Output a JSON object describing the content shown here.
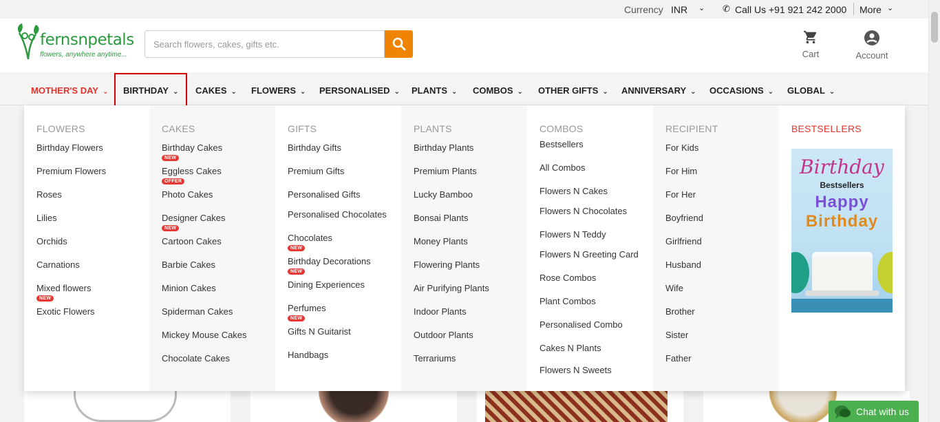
{
  "topbar": {
    "currency_label": "Currency",
    "currency_value": "INR",
    "call": "Call Us +91 921 242 2000",
    "more": "More"
  },
  "header": {
    "logo_brand": "fernsnpetals",
    "logo_tagline": "flowers, anywhere anytime...",
    "search_placeholder": "Search flowers, cakes, gifts etc.",
    "cart_label": "Cart",
    "account_label": "Account"
  },
  "nav": {
    "items": [
      "MOTHER'S DAY",
      "BIRTHDAY",
      "CAKES",
      "FLOWERS",
      "PERSONALISED",
      "PLANTS",
      "COMBOS",
      "OTHER GIFTS",
      "ANNIVERSARY",
      "OCCASIONS",
      "GLOBAL"
    ],
    "accent_color": "#e2342c"
  },
  "mega_menu": {
    "flowers": {
      "title": "FLOWERS",
      "items": [
        "Birthday Flowers",
        "Premium Flowers",
        "Roses",
        "Lilies",
        "Orchids",
        "Carnations",
        "Mixed flowers",
        "Exotic Flowers"
      ],
      "badges": {
        "7": "NEW"
      }
    },
    "cakes": {
      "title": "CAKES",
      "items": [
        "Birthday Cakes",
        "Eggless Cakes",
        "Photo Cakes",
        "Designer Cakes",
        "Cartoon Cakes",
        "Barbie Cakes",
        "Minion Cakes",
        "Spiderman Cakes",
        "Mickey Mouse Cakes",
        "Chocolate Cakes"
      ],
      "badges": {
        "1": "NEW",
        "2": "OFFER",
        "4": "NEW"
      }
    },
    "gifts": {
      "title": "GIFTS",
      "items": [
        "Birthday Gifts",
        "Premium Gifts",
        "Personalised Gifts",
        "Personalised Chocolates",
        "Chocolates",
        "Birthday Decorations",
        "Dining Experiences",
        "Perfumes",
        "Gifts N Guitarist",
        "Handbags"
      ],
      "badges": {
        "5": "NEW",
        "6": "NEW",
        "8": "NEW"
      }
    },
    "plants": {
      "title": "PLANTS",
      "items": [
        "Birthday Plants",
        "Premium Plants",
        "Lucky Bamboo",
        "Bonsai Plants",
        "Money Plants",
        "Flowering Plants",
        "Air Purifying Plants",
        "Indoor Plants",
        "Outdoor Plants",
        "Terrariums"
      ]
    },
    "combos": {
      "title": "COMBOS",
      "items": [
        "Bestsellers",
        "All Combos",
        "Flowers N Cakes",
        "Flowers N Chocolates",
        "Flowers N Teddy",
        "Flowers N Greeting Card",
        "Rose Combos",
        "Plant Combos",
        "Personalised Combo",
        "Cakes N Plants",
        "Flowers N Sweets"
      ]
    },
    "recipient": {
      "title": "RECIPIENT",
      "items": [
        "For Kids",
        "For Him",
        "For Her",
        "Boyfriend",
        "Girlfriend",
        "Husband",
        "Wife",
        "Brother",
        "Sister",
        "Father"
      ]
    },
    "bestsellers": {
      "title": "BESTSELLERS",
      "image_script": "Birthday",
      "image_caption": "Bestsellers",
      "image_happy": "Happy",
      "image_birthday": "Birthday"
    }
  },
  "chat": {
    "label": "Chat with us"
  }
}
